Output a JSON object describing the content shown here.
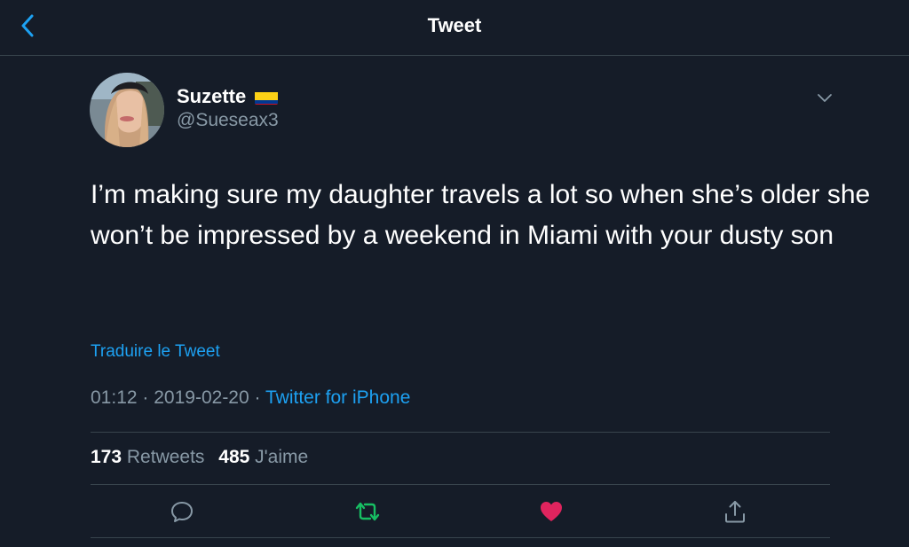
{
  "header": {
    "title": "Tweet",
    "back_icon": "chevron-left-icon"
  },
  "author": {
    "display_name": "Suzette",
    "flag_icon": "colombia-flag-icon",
    "handle": "@Sueseax3"
  },
  "tweet": {
    "text": "I’m making sure my daughter travels a lot so when she’s older she won’t be impressed by a weekend in Miami with your dusty son",
    "translate_label": "Traduire le Tweet",
    "time": "01:12",
    "separator": "·",
    "date": "2019-02-20",
    "source": "Twitter for iPhone"
  },
  "stats": {
    "retweets_count": "173",
    "retweets_label": "Retweets",
    "likes_count": "485",
    "likes_label": "J'aime"
  },
  "actions": {
    "reply_icon": "reply-icon",
    "retweet_icon": "retweet-icon",
    "like_icon": "heart-icon",
    "share_icon": "share-icon"
  },
  "colors": {
    "background": "#151c28",
    "accent": "#1da1f2",
    "muted_text": "#8899a6",
    "divider": "#38444d",
    "retweet_active": "#17bf63",
    "like_active": "#e0245e"
  }
}
